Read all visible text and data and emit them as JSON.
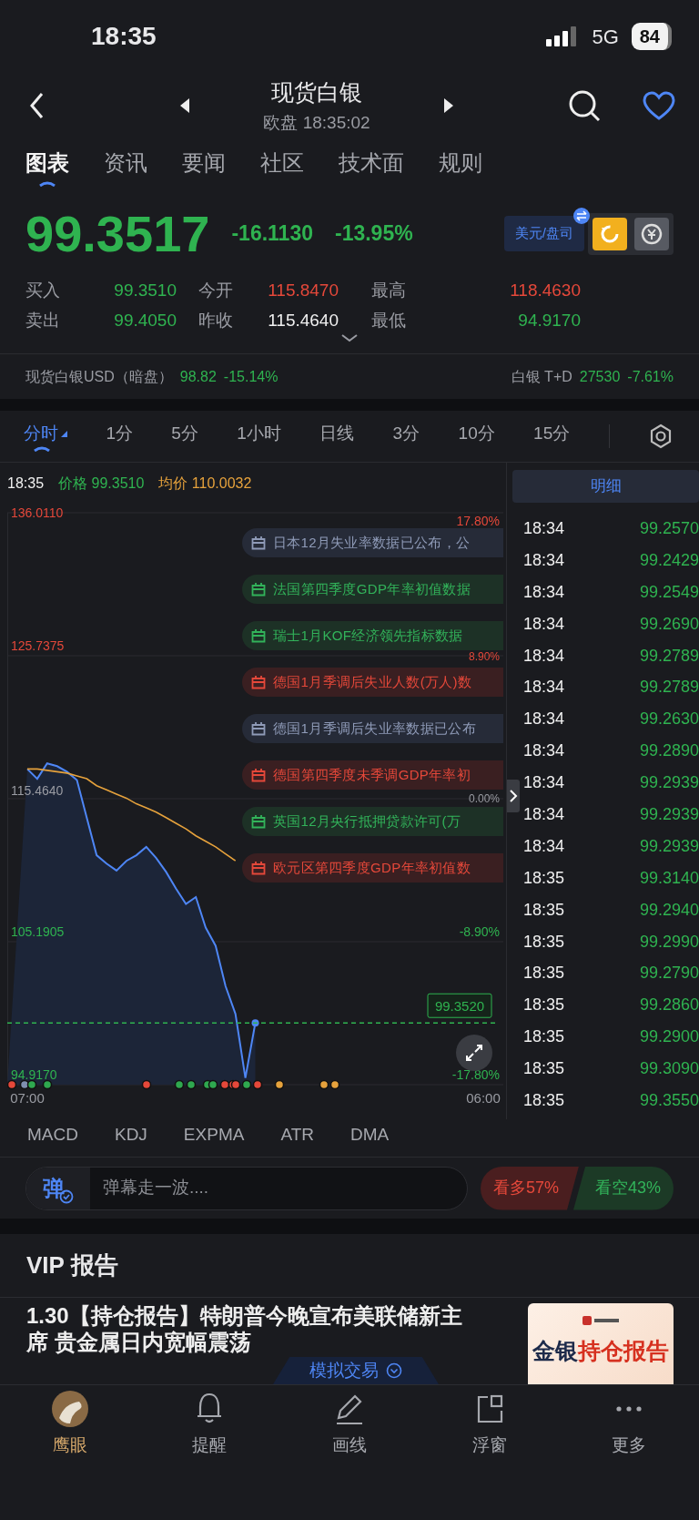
{
  "status_bar": {
    "time": "18:35",
    "network": "5G",
    "battery": "84"
  },
  "header": {
    "title": "现货白银",
    "subtitle": "欧盘 18:35:02",
    "favorite": true
  },
  "tabs": [
    {
      "label": "图表",
      "selected": true
    },
    {
      "label": "资讯",
      "selected": false
    },
    {
      "label": "要闻",
      "selected": false
    },
    {
      "label": "社区",
      "selected": false
    },
    {
      "label": "技术面",
      "selected": false
    },
    {
      "label": "规则",
      "selected": false
    }
  ],
  "quote": {
    "price": "99.3517",
    "change": "-16.1130",
    "change_pct": "-13.95%",
    "color": "#2fb350",
    "unit": "美元/盘司"
  },
  "stats": [
    {
      "label": "买入",
      "value": "99.3510",
      "color": "#2fb350"
    },
    {
      "label": "今开",
      "value": "115.8470",
      "color": "#e5483a"
    },
    {
      "label": "最高",
      "value": "118.4630",
      "color": "#e5483a"
    },
    {
      "label": "卖出",
      "value": "99.4050",
      "color": "#2fb350"
    },
    {
      "label": "昨收",
      "value": "115.4640",
      "color": "#f0f0f0"
    },
    {
      "label": "最低",
      "value": "94.9170",
      "color": "#2fb350"
    }
  ],
  "related": [
    {
      "name": "现货白银USD（暗盘）",
      "price": "98.82",
      "change": "-15.14%",
      "color": "#2fb350"
    },
    {
      "name": "白银 T+D",
      "price": "27530",
      "change": "-7.61%",
      "color": "#2fb350"
    }
  ],
  "periods": [
    {
      "label": "分时",
      "selected": true
    },
    {
      "label": "1分",
      "selected": false
    },
    {
      "label": "5分",
      "selected": false
    },
    {
      "label": "1小时",
      "selected": false
    },
    {
      "label": "日线",
      "selected": false
    },
    {
      "label": "3分",
      "selected": false
    },
    {
      "label": "10分",
      "selected": false
    },
    {
      "label": "15分",
      "selected": false
    }
  ],
  "chart": {
    "time": "18:35",
    "price": "99.3510",
    "avg": "110.0032",
    "current_tag": "99.3520",
    "right_labels": [
      "17.80%",
      "8.90%",
      "0.00%",
      "-8.90%",
      "-17.80%"
    ],
    "events": [
      {
        "kind": "neutral",
        "text": "日本12月失业率数据已公布，公"
      },
      {
        "kind": "positive",
        "text": "法国第四季度GDP年率初值数据"
      },
      {
        "kind": "positive",
        "text": "瑞士1月KOF经济领先指标数据"
      },
      {
        "kind": "negative",
        "text": "德国1月季调后失业人数(万人)数"
      },
      {
        "kind": "neutral",
        "text": "德国1月季调后失业率数据已公布"
      },
      {
        "kind": "negative",
        "text": "德国第四季度未季调GDP年率初"
      },
      {
        "kind": "positive",
        "text": "英国12月央行抵押贷款许可(万"
      },
      {
        "kind": "negative",
        "text": "欧元区第四季度GDP年率初值数"
      }
    ],
    "event_markers": [
      {
        "color": "#e5483a"
      },
      {
        "color": "#7f8fb0"
      },
      {
        "color": "#2fa84f"
      },
      {
        "color": "#2fa84f"
      },
      {
        "color": "#e5483a"
      },
      {
        "color": "#2fa84f"
      },
      {
        "color": "#2fa84f"
      },
      {
        "color": "#2fa84f"
      },
      {
        "color": "#2fa84f"
      },
      {
        "color": "#e5483a"
      },
      {
        "color": "#e5483a"
      },
      {
        "color": "#e5483a"
      },
      {
        "color": "#2fa84f"
      },
      {
        "color": "#e5483a"
      },
      {
        "color": "#e6a23c"
      },
      {
        "color": "#e6a23c"
      },
      {
        "color": "#e6a23c"
      }
    ],
    "chart_data": {
      "type": "line",
      "grid": true,
      "categories": [
        "07:00",
        null,
        null,
        null,
        null,
        null,
        null,
        null,
        null,
        null,
        null,
        null,
        null,
        null,
        null,
        null,
        null,
        null,
        null,
        null,
        null,
        null,
        null,
        null,
        null,
        null,
        null,
        null,
        null,
        null,
        null,
        null,
        null,
        null,
        null,
        null,
        null,
        null,
        null,
        null,
        null,
        null,
        null,
        null,
        null,
        null,
        "06:00"
      ],
      "ylim": [
        94.917,
        136.011
      ],
      "yticks": [
        {
          "value": 136.011,
          "label": "136.0110"
        },
        {
          "value": 125.7375,
          "label": "125.7375"
        },
        {
          "value": 115.464,
          "label": "115.4640"
        },
        {
          "value": 105.1905,
          "label": "105.1905"
        },
        {
          "value": 94.917,
          "label": "94.9170"
        }
      ],
      "series": [
        {
          "name": "价格",
          "color": "#4e86f5",
          "values": [
            117.6,
            116.9,
            118.0,
            117.8,
            117.4,
            116.8,
            114.1,
            111.4,
            110.8,
            110.3,
            111.0,
            111.4,
            112.0,
            111.2,
            110.2,
            109.0,
            107.9,
            108.4,
            106.2,
            104.9,
            102.0,
            100.0,
            95.4,
            99.35,
            null,
            null,
            null,
            null,
            null,
            null,
            null,
            null,
            null,
            null,
            null,
            null,
            null,
            null,
            null,
            null,
            null,
            null,
            null,
            null,
            null,
            null,
            null
          ]
        },
        {
          "name": "均价",
          "color": "#e6a23c",
          "values": [
            117.6,
            117.6,
            117.5,
            117.4,
            117.3,
            117.1,
            116.9,
            116.4,
            116.1,
            115.8,
            115.5,
            115.1,
            114.8,
            114.5,
            114.1,
            113.7,
            113.3,
            112.8,
            112.4,
            112.0,
            111.5,
            111.0,
            null,
            null,
            null,
            null,
            null,
            null,
            null,
            null,
            null,
            null,
            null,
            null,
            null,
            null,
            null,
            null,
            null,
            null,
            null,
            null,
            null,
            null,
            null,
            null,
            null
          ]
        }
      ],
      "stacked": false
    }
  },
  "details": {
    "title": "明细",
    "rows": [
      {
        "time": "18:34",
        "price": "99.2570"
      },
      {
        "time": "18:34",
        "price": "99.2429"
      },
      {
        "time": "18:34",
        "price": "99.2549"
      },
      {
        "time": "18:34",
        "price": "99.2690"
      },
      {
        "time": "18:34",
        "price": "99.2789"
      },
      {
        "time": "18:34",
        "price": "99.2789"
      },
      {
        "time": "18:34",
        "price": "99.2630"
      },
      {
        "time": "18:34",
        "price": "99.2890"
      },
      {
        "time": "18:34",
        "price": "99.2939"
      },
      {
        "time": "18:34",
        "price": "99.2939"
      },
      {
        "time": "18:34",
        "price": "99.2939"
      },
      {
        "time": "18:35",
        "price": "99.3140"
      },
      {
        "time": "18:35",
        "price": "99.2940"
      },
      {
        "time": "18:35",
        "price": "99.2990"
      },
      {
        "time": "18:35",
        "price": "99.2790"
      },
      {
        "time": "18:35",
        "price": "99.2860"
      },
      {
        "time": "18:35",
        "price": "99.2900"
      },
      {
        "time": "18:35",
        "price": "99.3090"
      },
      {
        "time": "18:35",
        "price": "99.3550"
      }
    ]
  },
  "indicators": [
    "MACD",
    "KDJ",
    "EXPMA",
    "ATR",
    "DMA"
  ],
  "danmaku": {
    "icon_text": "弹",
    "placeholder": "弹幕走一波...."
  },
  "sentiment": [
    {
      "kind": "bull",
      "label": "看多57%"
    },
    {
      "kind": "bear",
      "label": "看空43%"
    }
  ],
  "vip": {
    "title": "VIP 报告",
    "article_title": "1.30【持仓报告】特朗普今晚宣布美联储新主席  贵金属日内宽幅震荡",
    "thumbnail": [
      "金银",
      "持仓报告"
    ],
    "floating_tab": "模拟交易"
  },
  "bottom_nav": [
    {
      "kind": "avatar",
      "label": "鹰眼",
      "selected": true
    },
    {
      "kind": "bell",
      "label": "提醒",
      "selected": false
    },
    {
      "kind": "pen",
      "label": "画线",
      "selected": false
    },
    {
      "kind": "window",
      "label": "浮窗",
      "selected": false
    },
    {
      "kind": "more",
      "label": "更多",
      "selected": false
    }
  ]
}
